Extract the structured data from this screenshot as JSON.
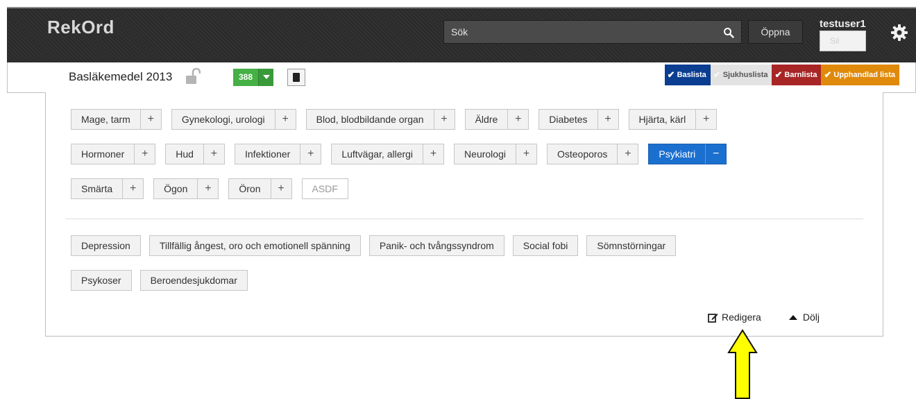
{
  "header": {
    "app_name": "RekOrd",
    "search_placeholder": "Sök",
    "open_label": "Öppna",
    "user_name": "testuser1",
    "user_sub": "Sil"
  },
  "subbar": {
    "document_title": "Basläkemedel 2013",
    "count": "388",
    "lists": [
      {
        "label": "Baslista",
        "color": "#0b3d91"
      },
      {
        "label": "Sjukhuslista",
        "color": "#e3e3e3"
      },
      {
        "label": "Barnlista",
        "color": "#a82525"
      },
      {
        "label": "Upphandlad lista",
        "color": "#e08a0b"
      }
    ]
  },
  "categories": {
    "row1": [
      "Mage, tarm",
      "Gynekologi, urologi",
      "Blod, blodbildande organ",
      "Äldre",
      "Diabetes",
      "Hjärta, kärl"
    ],
    "row2": [
      "Hormoner",
      "Hud",
      "Infektioner",
      "Luftvägar, allergi",
      "Neurologi",
      "Osteoporos",
      "Psykiatri"
    ],
    "row3": [
      "Smärta",
      "Ögon",
      "Öron"
    ],
    "plain": "ASDF",
    "active": "Psykiatri",
    "plus_symbol": "+",
    "minus_symbol": "−"
  },
  "subcategories": {
    "row1": [
      "Depression",
      "Tillfällig ångest, oro och emotionell spänning",
      "Panik- och tvångssyndrom",
      "Social fobi",
      "Sömnstörningar"
    ],
    "row2": [
      "Psykoser",
      "Beroendesjukdomar"
    ]
  },
  "actions": {
    "edit_label": "Redigera",
    "hide_label": "Dölj"
  },
  "colors": {
    "accent_blue": "#1b6fcf",
    "count_green": "#45b045",
    "annotation_arrow": "#ffff00"
  }
}
